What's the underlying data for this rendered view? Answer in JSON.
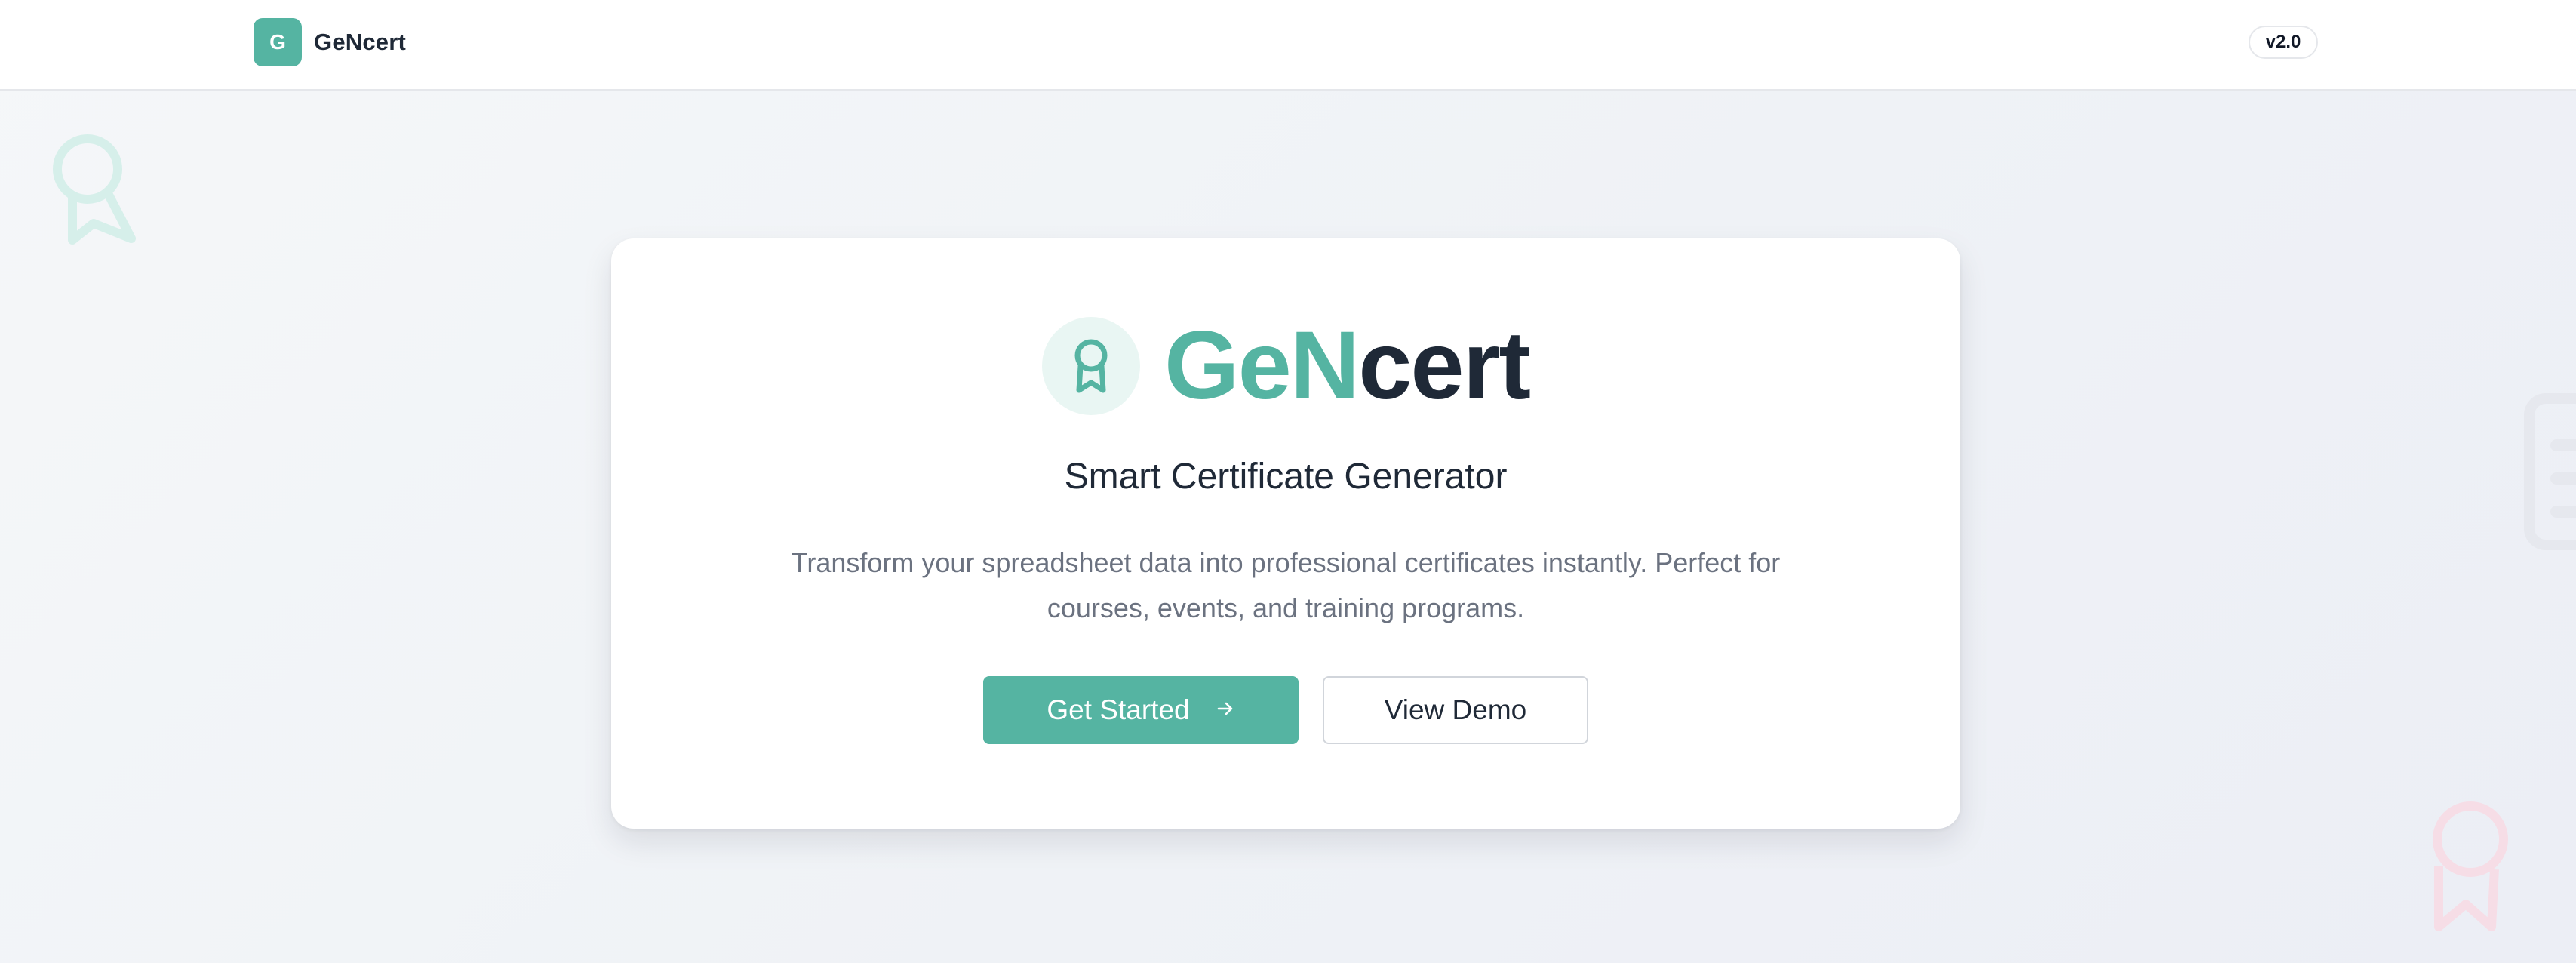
{
  "header": {
    "logo_letter": "G",
    "app_name": "GeNcert",
    "version": "v2.0"
  },
  "hero": {
    "logo_part_green": "GeN",
    "logo_part_dark": "cert",
    "subtitle": "Smart Certificate Generator",
    "description": "Transform your spreadsheet data into professional certificates instantly. Perfect for courses, events, and training programs.",
    "primary_button_label": "Get Started",
    "primary_button_icon": "arrow-right-icon",
    "secondary_button_label": "View Demo",
    "hero_icon": "award-icon"
  },
  "colors": {
    "brand": "#55b4a2",
    "text_dark": "#1f2937",
    "text_muted": "#6b7280",
    "deco_green": "#d6efea",
    "deco_pink": "#f6dde6",
    "deco_gray": "#e6e8ee"
  }
}
